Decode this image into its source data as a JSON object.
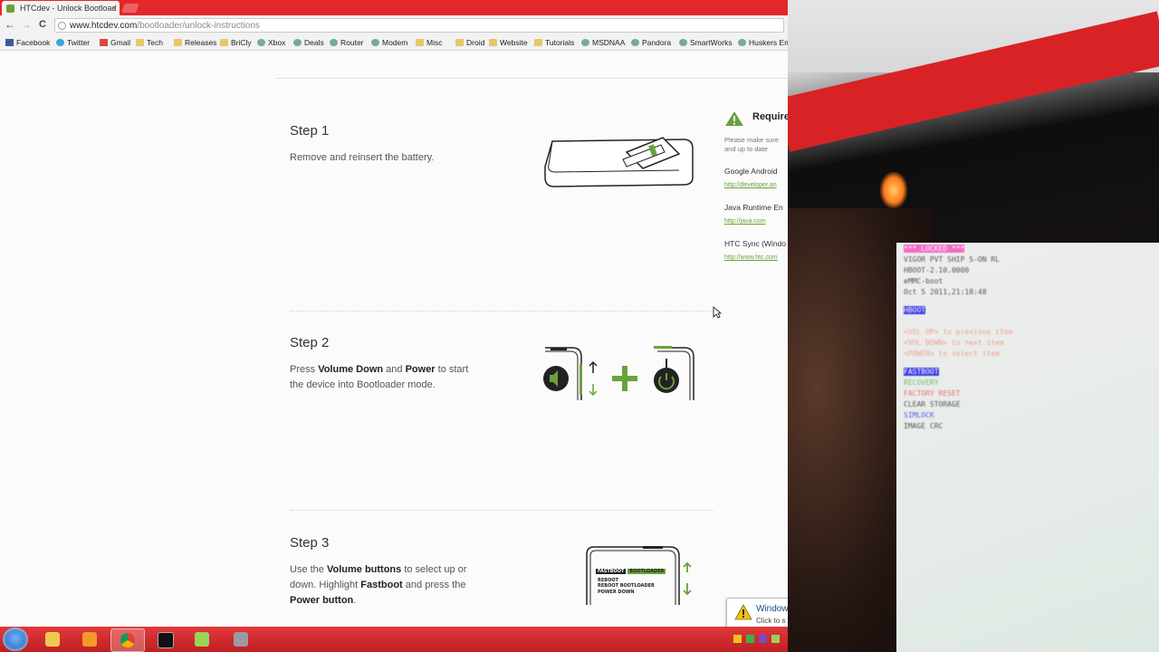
{
  "browser": {
    "tab_title": "HTCdev - Unlock Bootload",
    "tab_close": "×",
    "url_host": "www.htcdev.com",
    "url_path": "/bootloader/unlock-instructions",
    "nav": {
      "back": "←",
      "forward": "→",
      "reload": "C"
    },
    "bookmarks": [
      {
        "label": "Facebook",
        "icon": "facebook-icon"
      },
      {
        "label": "Twitter",
        "icon": "twitter-icon"
      },
      {
        "label": "Gmail",
        "icon": "gmail-icon"
      },
      {
        "label": "Tech",
        "icon": "folder-icon"
      },
      {
        "label": "Releases",
        "icon": "folder-icon"
      },
      {
        "label": "BriCly",
        "icon": "folder-icon"
      },
      {
        "label": "Xbox",
        "icon": "xbox-icon"
      },
      {
        "label": "Deals",
        "icon": "site-icon"
      },
      {
        "label": "Router",
        "icon": "site-icon"
      },
      {
        "label": "Modem",
        "icon": "site-icon"
      },
      {
        "label": "Misc",
        "icon": "folder-icon"
      },
      {
        "label": "Droid",
        "icon": "folder-icon"
      },
      {
        "label": "Website",
        "icon": "folder-icon"
      },
      {
        "label": "Tutorials",
        "icon": "folder-icon"
      },
      {
        "label": "MSDNAA",
        "icon": "site-icon"
      },
      {
        "label": "Pandora",
        "icon": "site-icon"
      },
      {
        "label": "SmartWorks",
        "icon": "site-icon"
      },
      {
        "label": "Huskers Em",
        "icon": "site-icon"
      }
    ]
  },
  "steps": [
    {
      "title": "Step 1",
      "text": "Remove and reinsert the battery."
    },
    {
      "title": "Step 2",
      "pre": "Press ",
      "b1": "Volume Down",
      "mid": " and ",
      "b2": "Power",
      "post": " to start the device into Bootloader mode."
    },
    {
      "title": "Step 3",
      "pre": "Use the ",
      "b1": "Volume buttons",
      "mid": " to select up or down. Highlight ",
      "b2": "Fastboot",
      "mid2": " and press the ",
      "b3": "Power button",
      "post": "."
    }
  ],
  "phone_menu": [
    "FASTBOOT",
    "BOOTLOADER",
    "REBOOT",
    "REBOOT BOOTLOADER",
    "POWER DOWN"
  ],
  "requirements": {
    "title": "Require",
    "note_line1": "Please make sure",
    "note_line2": "and up to date",
    "items": [
      {
        "name": "Google Android",
        "link": "http://developer.an"
      },
      {
        "name": "Java Runtime En",
        "link": "http://java.com"
      },
      {
        "name": "HTC Sync (Windo",
        "link": "http://www.htc.com"
      }
    ]
  },
  "notification": {
    "title": "Window",
    "subtitle": "Click to s"
  },
  "camera": {
    "lines": [
      {
        "text": "*** LOCKED ***",
        "style": "pink"
      },
      {
        "text": "VIGOR PVT SHIP S-ON RL",
        "style": "dark"
      },
      {
        "text": "HBOOT-2.10.0000",
        "style": "dark"
      },
      {
        "text": "eMMC-boot",
        "style": "dark"
      },
      {
        "text": "Oct  5 2011,21:18:48",
        "style": "dark"
      },
      {
        "text": "HBOOT",
        "style": "hi"
      },
      {
        "text": "<VOL UP> to previous item",
        "style": "red"
      },
      {
        "text": "<VOL DOWN> to next item",
        "style": "red"
      },
      {
        "text": "<POWER> to select item",
        "style": "red"
      },
      {
        "text": "FASTBOOT",
        "style": "hi"
      },
      {
        "text": "RECOVERY",
        "style": "green"
      },
      {
        "text": "FACTORY RESET",
        "style": "orange"
      },
      {
        "text": "CLEAR STORAGE",
        "style": "dark"
      },
      {
        "text": "SIMLOCK",
        "style": "blue"
      },
      {
        "text": "IMAGE CRC",
        "style": "dark"
      }
    ]
  },
  "colors": {
    "accent_green": "#6aa23a",
    "brand_red": "#e4272a"
  }
}
